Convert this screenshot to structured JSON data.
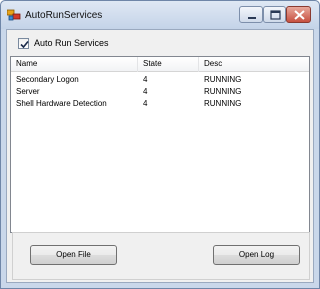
{
  "window": {
    "title": "AutoRunServices"
  },
  "options": {
    "auto_run_label": "Auto Run Services",
    "auto_run_checked": true
  },
  "services_list": {
    "columns": [
      "Name",
      "State",
      "Desc"
    ],
    "rows": [
      {
        "name": "Secondary Logon",
        "state": "4",
        "desc": "RUNNING"
      },
      {
        "name": "Server",
        "state": "4",
        "desc": "RUNNING"
      },
      {
        "name": "Shell Hardware Detection",
        "state": "4",
        "desc": "RUNNING"
      }
    ]
  },
  "buttons": {
    "open_file": "Open File",
    "open_log": "Open Log"
  }
}
